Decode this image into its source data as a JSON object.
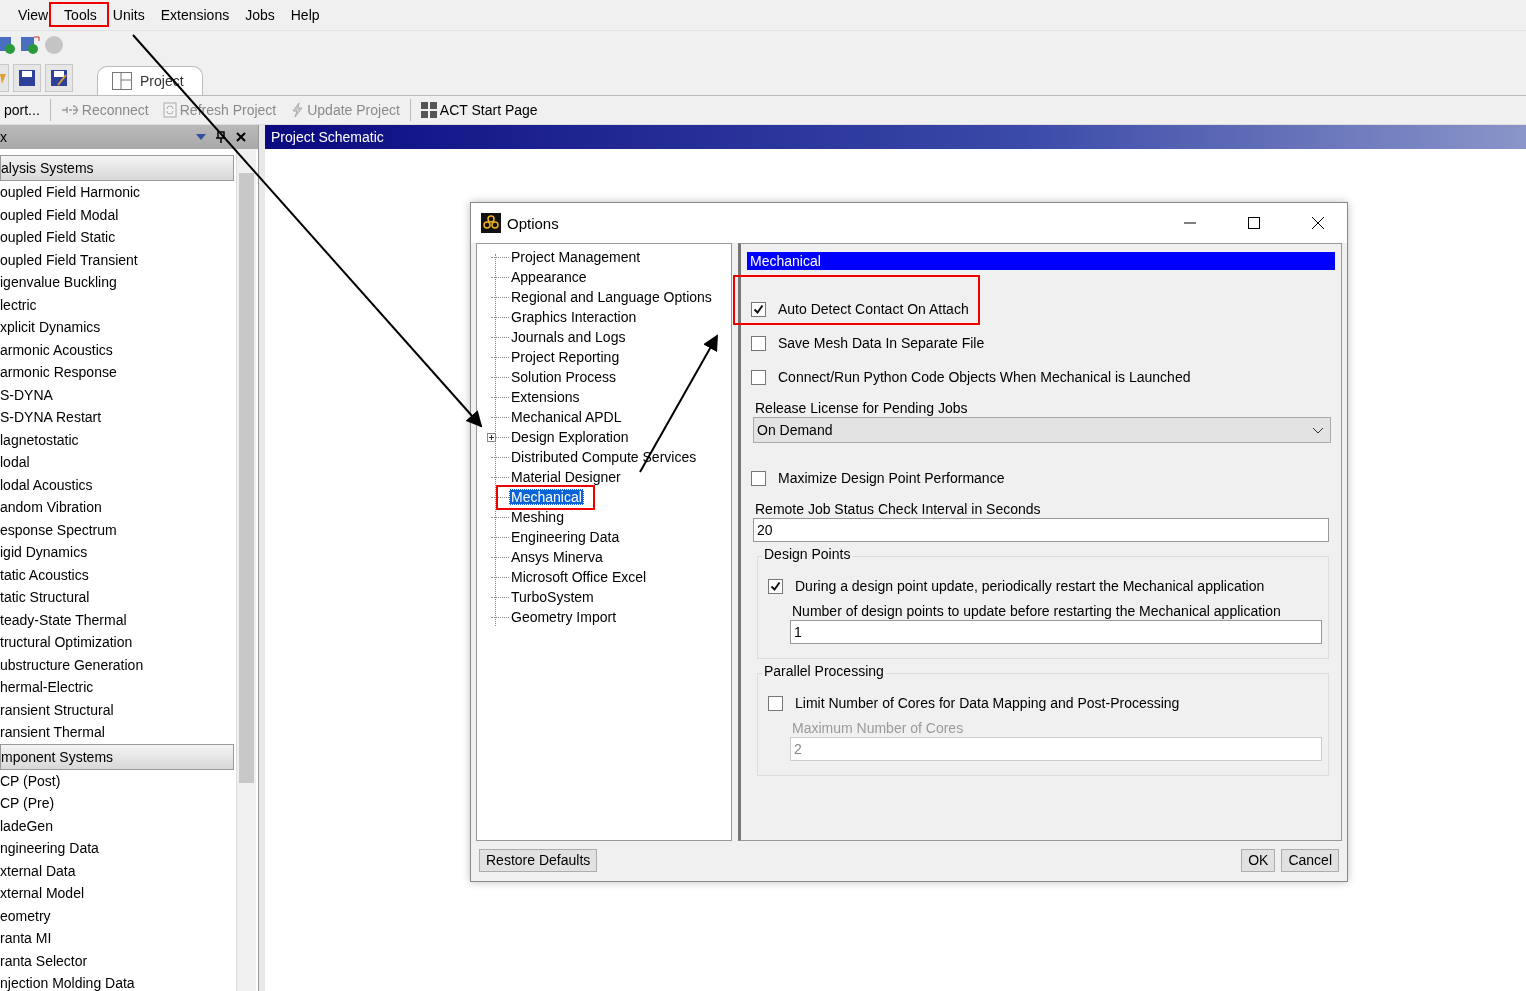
{
  "menu": [
    {
      "label": "View"
    },
    {
      "label": "Tools"
    },
    {
      "label": "Units"
    },
    {
      "label": "Extensions"
    },
    {
      "label": "Jobs"
    },
    {
      "label": "Help"
    }
  ],
  "tab": {
    "label": "Project"
  },
  "toolbar": [
    {
      "label": "port...",
      "disabled": false,
      "kind": "text"
    },
    {
      "label": "Reconnect",
      "disabled": true,
      "kind": "reconnect"
    },
    {
      "label": "Refresh Project",
      "disabled": true,
      "kind": "refresh"
    },
    {
      "label": "Update Project",
      "disabled": true,
      "kind": "update"
    },
    {
      "label": "ACT Start Page",
      "disabled": false,
      "kind": "grid"
    }
  ],
  "toolbox": {
    "title": "x",
    "groups": [
      {
        "label": "alysis Systems",
        "items": [
          "oupled Field Harmonic",
          "oupled Field Modal",
          "oupled Field Static",
          "oupled Field Transient",
          "igenvalue Buckling",
          "lectric",
          "xplicit Dynamics",
          "armonic Acoustics",
          "armonic Response",
          "S-DYNA",
          "S-DYNA Restart",
          "lagnetostatic",
          "lodal",
          "lodal Acoustics",
          "andom Vibration",
          "esponse Spectrum",
          "igid Dynamics",
          "tatic Acoustics",
          "tatic Structural",
          "teady-State Thermal",
          "tructural Optimization",
          "ubstructure Generation",
          "hermal-Electric",
          "ransient Structural",
          "ransient Thermal"
        ]
      },
      {
        "label": "mponent Systems",
        "items": [
          "CP (Post)",
          "CP (Pre)",
          "ladeGen",
          "ngineering Data",
          "xternal Data",
          "xternal Model",
          "eometry",
          "ranta MI",
          "ranta Selector",
          "njection Molding Data"
        ]
      }
    ]
  },
  "schematic": {
    "title": "Project Schematic"
  },
  "dialog": {
    "title": "Options",
    "tree": [
      {
        "label": "Project Management",
        "kind": "leaf",
        "selected": false
      },
      {
        "label": "Appearance",
        "kind": "leaf",
        "selected": false
      },
      {
        "label": "Regional and Language Options",
        "kind": "leaf",
        "selected": false
      },
      {
        "label": "Graphics Interaction",
        "kind": "leaf",
        "selected": false
      },
      {
        "label": "Journals and Logs",
        "kind": "leaf",
        "selected": false
      },
      {
        "label": "Project Reporting",
        "kind": "leaf",
        "selected": false
      },
      {
        "label": "Solution Process",
        "kind": "leaf",
        "selected": false
      },
      {
        "label": "Extensions",
        "kind": "leaf",
        "selected": false
      },
      {
        "label": "Mechanical APDL",
        "kind": "leaf",
        "selected": false
      },
      {
        "label": "Design Exploration",
        "kind": "collapsed",
        "selected": false
      },
      {
        "label": "Distributed Compute Services",
        "kind": "leaf",
        "selected": false
      },
      {
        "label": "Material Designer",
        "kind": "leaf",
        "selected": false
      },
      {
        "label": "Mechanical",
        "kind": "leaf",
        "selected": true
      },
      {
        "label": "Meshing",
        "kind": "leaf",
        "selected": false
      },
      {
        "label": "Engineering Data",
        "kind": "leaf",
        "selected": false
      },
      {
        "label": "Ansys Minerva",
        "kind": "leaf",
        "selected": false
      },
      {
        "label": "Microsoft Office Excel",
        "kind": "leaf",
        "selected": false
      },
      {
        "label": "TurboSystem",
        "kind": "leaf",
        "selected": false
      },
      {
        "label": "Geometry Import",
        "kind": "leaf",
        "selected": false
      }
    ],
    "panel_title": "Mechanical",
    "settings": [
      {
        "kind": "checkbox",
        "label": "Auto Detect Contact On Attach",
        "checked": true
      },
      {
        "kind": "checkbox",
        "label": "Save Mesh Data In Separate File",
        "checked": false
      },
      {
        "kind": "checkbox",
        "label": "Connect/Run Python Code Objects When Mechanical is Launched",
        "checked": false
      },
      {
        "kind": "dropdown",
        "label": "Release License for Pending Jobs",
        "value": "On Demand"
      },
      {
        "kind": "checkbox",
        "label": "Maximize Design Point Performance",
        "checked": false
      },
      {
        "kind": "text",
        "label": "Remote Job Status Check Interval in Seconds",
        "value": "20",
        "disabled": false
      },
      {
        "kind": "group",
        "title": "Design Points",
        "items": [
          {
            "kind": "checkbox",
            "label": "During a design point update, periodically restart the Mechanical application",
            "checked": true
          },
          {
            "kind": "text",
            "label": "Number of design points to update before restarting the Mechanical application",
            "value": "1",
            "disabled": false
          }
        ]
      },
      {
        "kind": "group",
        "title": "Parallel Processing",
        "items": [
          {
            "kind": "checkbox",
            "label": "Limit Number of Cores for Data Mapping and Post-Processing",
            "checked": false
          },
          {
            "kind": "text",
            "label": "Maximum Number of Cores",
            "value": "2",
            "disabled": true
          }
        ]
      }
    ],
    "buttons": [
      {
        "label": "Restore Defaults"
      },
      {
        "label": "OK"
      },
      {
        "label": "Cancel"
      }
    ]
  }
}
